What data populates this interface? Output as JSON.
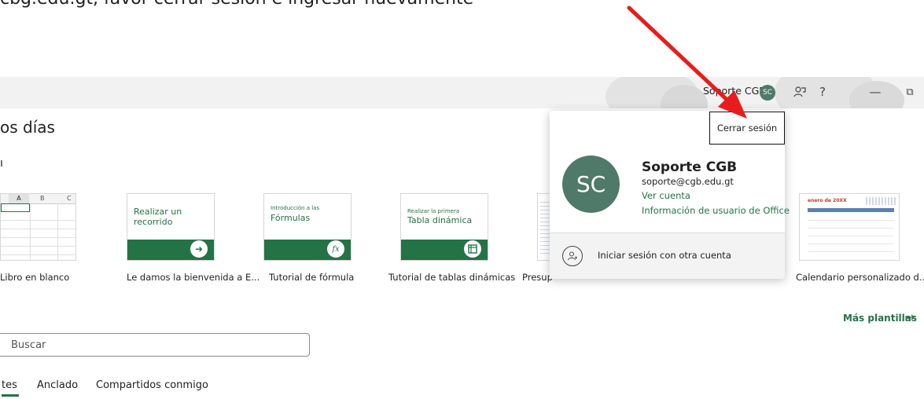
{
  "instruction_text": "cbg.edu.gt, favor cerrar sesión e ingresar nuevamente",
  "titlebar": {
    "account_name": "Soporte CGB",
    "avatar_initials": "SC",
    "help_label": "?",
    "minimize_label": "—",
    "restore_label": "⧉"
  },
  "greeting": "os días",
  "section_new_label": "ı",
  "templates": [
    {
      "caption": "Libro en blanco",
      "icon": "blank-workbook-icon"
    },
    {
      "caption": "Le damos la bienvenida a E...",
      "card_title": "Realizar un recorrido",
      "icon": "arrow-right-icon"
    },
    {
      "caption": "Tutorial de fórmula",
      "card_small": "Introducción a las",
      "card_title": "Fórmulas",
      "icon": "function-icon",
      "glyph": "fx"
    },
    {
      "caption": "Tutorial de tablas dinámicas",
      "card_small": "Realizar la primera",
      "card_title": "Tabla dinámica",
      "icon": "pivot-table-icon"
    },
    {
      "caption": "Presup",
      "icon": "budget-template-icon"
    },
    {
      "caption": "Calendario personalizado d...",
      "card_small": "enero de 20XX",
      "icon": "calendar-template-icon"
    }
  ],
  "spreadsheet_columns": [
    "A",
    "B",
    "C"
  ],
  "more_templates": "Más plantillas",
  "search": {
    "placeholder": "Buscar"
  },
  "tabs": [
    "tes",
    "Anclado",
    "Compartidos conmigo"
  ],
  "account_panel": {
    "sign_out": "Cerrar sesión",
    "avatar_initials": "SC",
    "name": "Soporte CGB",
    "email": "soporte@cgb.edu.gt",
    "view_account": "Ver cuenta",
    "office_info": "Información de usuario de Office",
    "switch_account": "Iniciar sesión con otra cuenta"
  },
  "colors": {
    "accent": "#237346",
    "avatar": "#4f7a69",
    "arrow": "#e81c1c"
  }
}
